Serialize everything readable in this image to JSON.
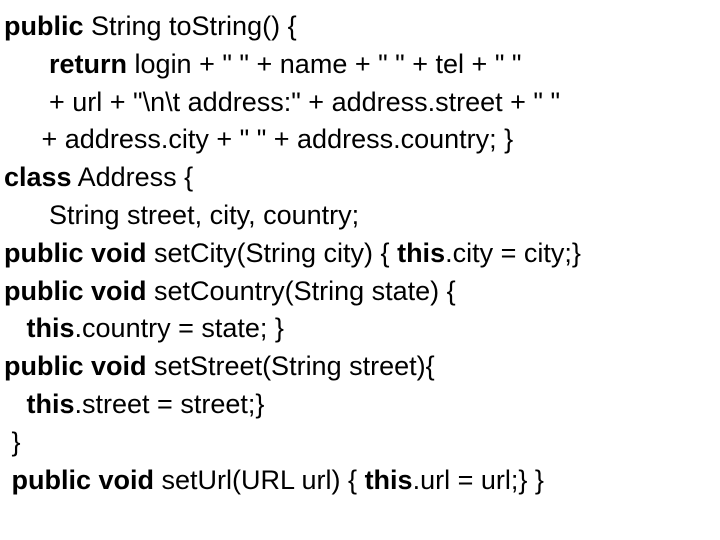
{
  "code": {
    "l1": {
      "kw1": "public",
      "t1": " String toString() { "
    },
    "l2": {
      "pad": "      ",
      "kw1": "return",
      "t1": " login + \" \" + name + \" \" + tel + \" \""
    },
    "l3": {
      "t1": "      + url + \"\\n\\t address:\" + address.street + \" \""
    },
    "l4": {
      "t1": "     + address.city + \" \" + address.country; }"
    },
    "l5": {
      "kw1": "class",
      "t1": " Address {"
    },
    "l6": {
      "t1": "      String street, city, country;"
    },
    "l7": {
      "kw1": "public void",
      "t1": " setCity(String city) { ",
      "kw2": "this",
      "t2": ".city = city;}"
    },
    "l8": {
      "kw1": "public void",
      "t1": " setCountry(String state) {"
    },
    "l9": {
      "pad": "   ",
      "kw1": "this",
      "t1": ".country = state; }"
    },
    "l10": {
      "kw1": "public void",
      "t1": " setStreet(String street){"
    },
    "l11": {
      "pad": "   ",
      "kw1": "this",
      "t1": ".street = street;}"
    },
    "l12": {
      "t1": " }"
    },
    "l13": {
      "pad": " ",
      "kw1": "public void",
      "t1": " setUrl(URL url) { ",
      "kw2": "this",
      "t2": ".url = url;} }"
    }
  }
}
